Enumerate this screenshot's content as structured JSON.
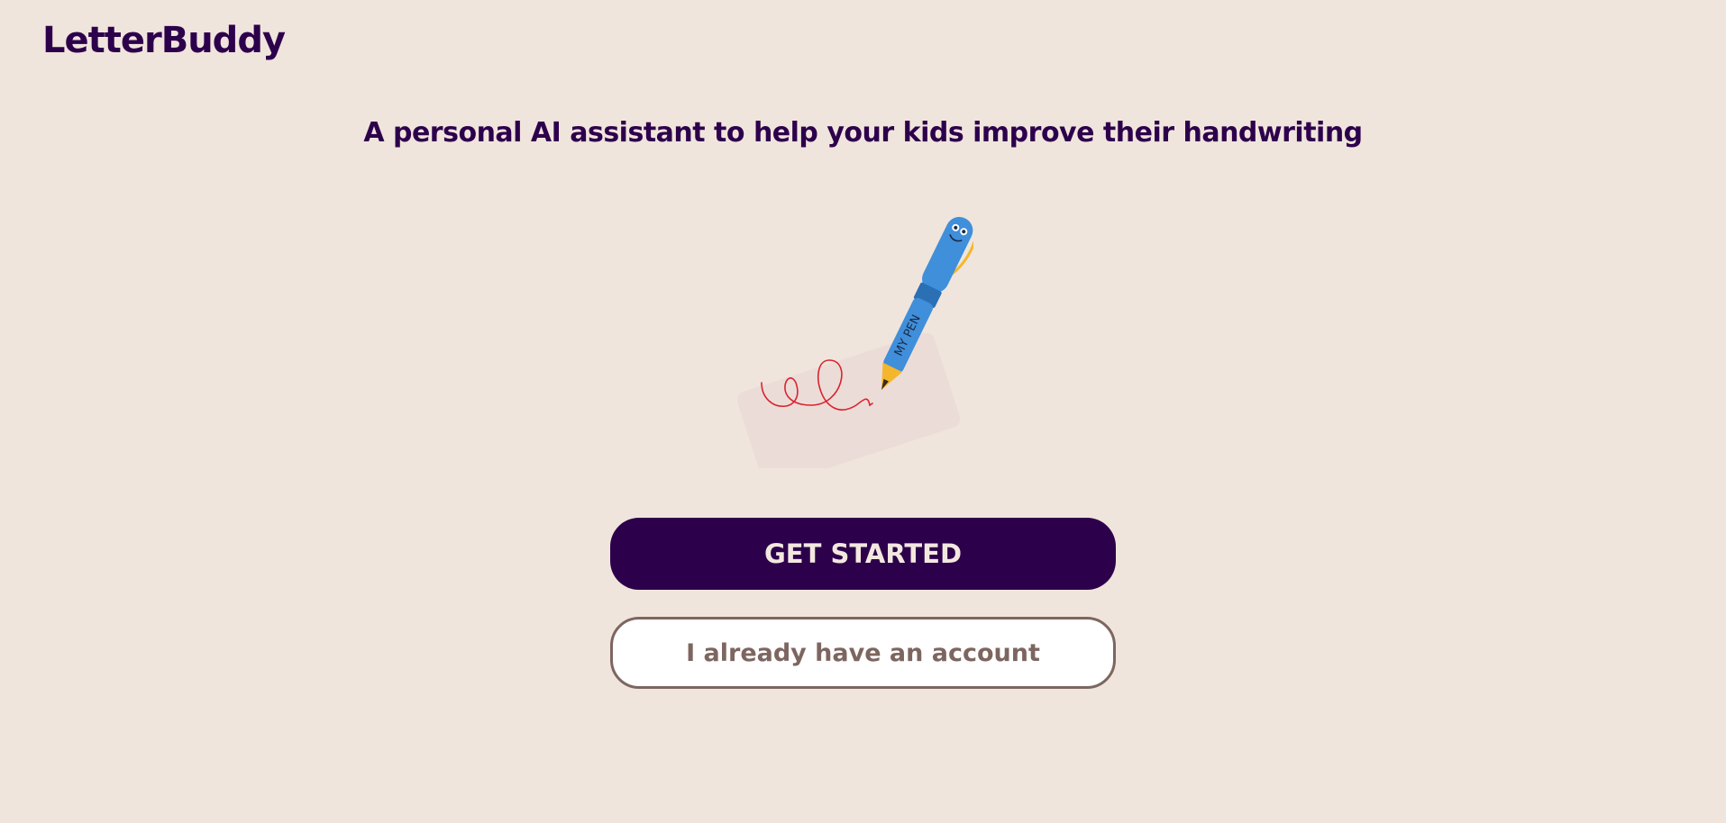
{
  "header": {
    "logo_text": "LetterBuddy"
  },
  "hero": {
    "tagline": "A personal AI assistant to help your kids improve their handwriting",
    "pen_label": "MY PEN"
  },
  "actions": {
    "primary_label": "GET STARTED",
    "secondary_label": "I already have an account"
  },
  "colors": {
    "background": "#f0e5dc",
    "brand": "#2d004c",
    "secondary_border": "#7d6660",
    "pen_blue": "#3f8fdb",
    "ink_red": "#d9232d"
  },
  "icons": {
    "illustration": "pen-writing-illustration"
  }
}
